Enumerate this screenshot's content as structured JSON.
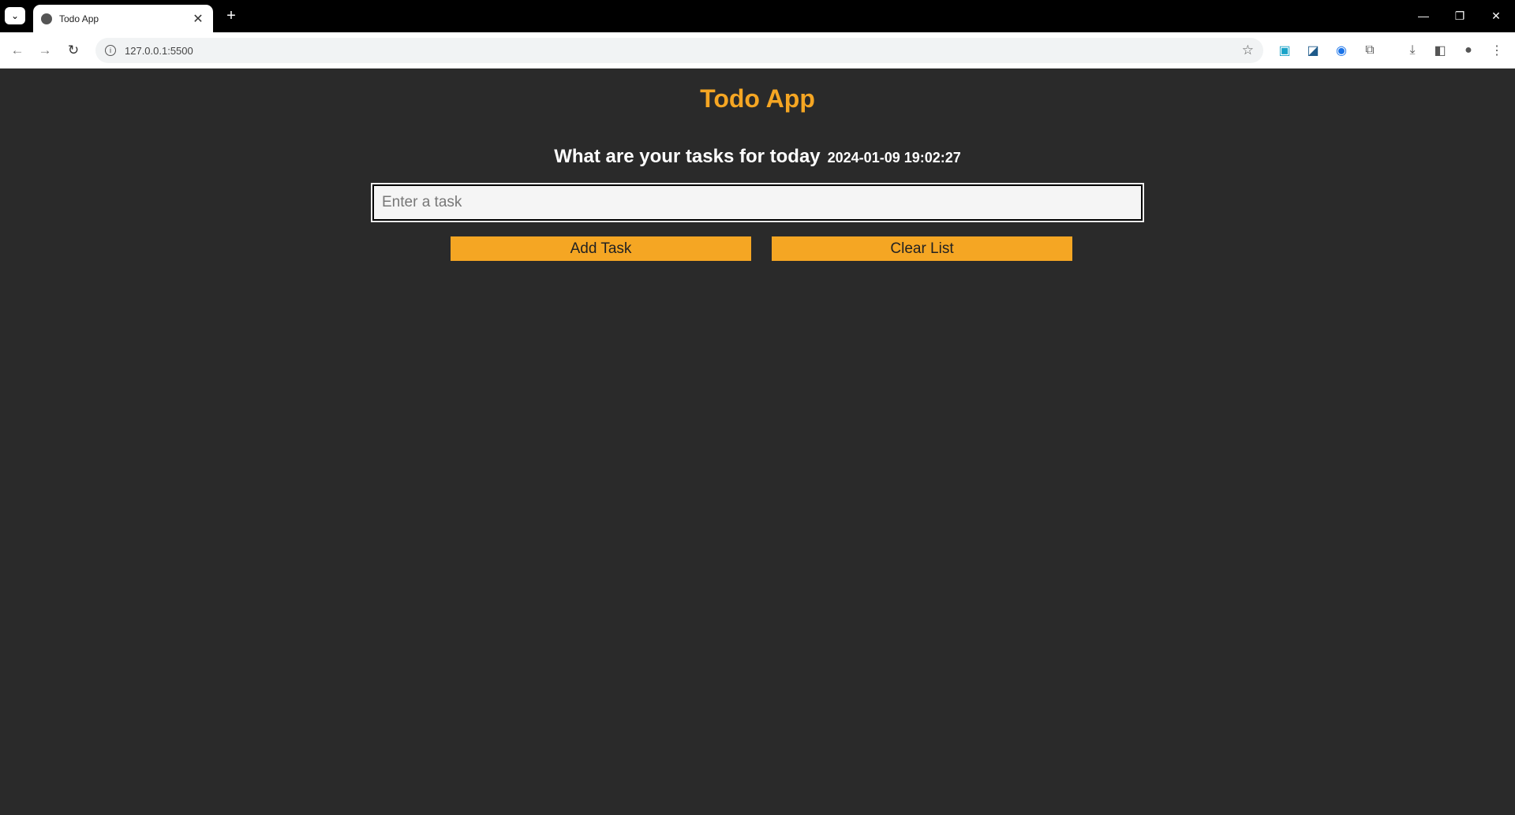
{
  "browser": {
    "tab_title": "Todo App",
    "url": "127.0.0.1:5500",
    "close_glyph": "✕",
    "new_tab_glyph": "+"
  },
  "app": {
    "title": "Todo App",
    "question": "What are your tasks for today",
    "datetime": "2024-01-09 19:02:27",
    "input": {
      "placeholder": "Enter a task",
      "value": ""
    },
    "buttons": {
      "add": "Add Task",
      "clear": "Clear List"
    }
  },
  "colors": {
    "accent": "#f5a623",
    "background": "#2a2a2a"
  }
}
